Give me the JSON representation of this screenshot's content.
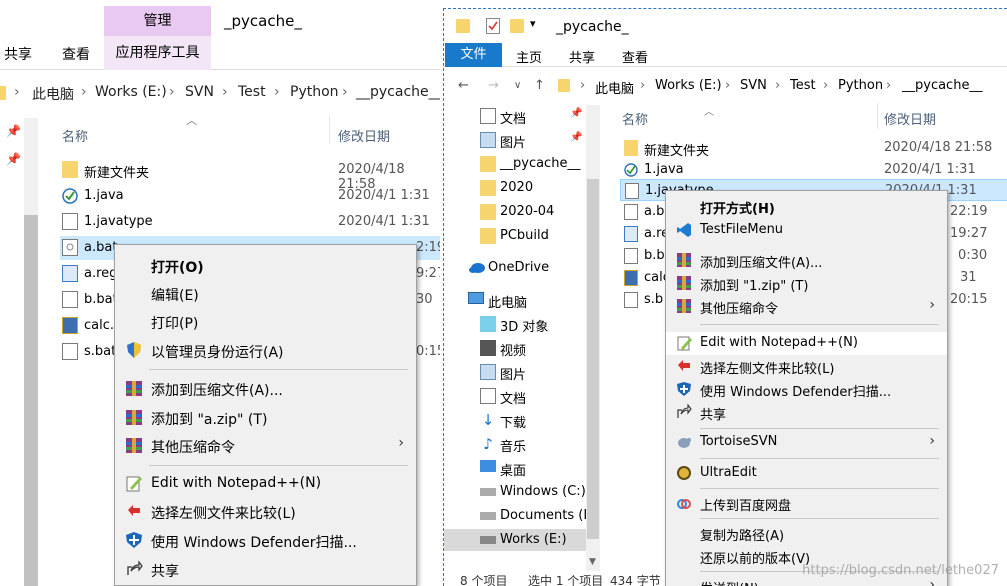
{
  "w1": {
    "manage_tab": "管理",
    "app_tools_tab": "应用程序工具",
    "share_tab": "共享",
    "view_tab": "查看",
    "title": "_pycache_",
    "addr": [
      "此电脑",
      "Works (E:)",
      "SVN",
      "Test",
      "Python",
      "__pycache__"
    ],
    "col_name": "名称",
    "col_date": "修改日期",
    "files": [
      {
        "name": "新建文件夹",
        "date": "2020/4/18 21:58"
      },
      {
        "name": "1.java",
        "date": "2020/4/1 1:31"
      },
      {
        "name": "1.javatype",
        "date": "2020/4/1 1:31"
      },
      {
        "name": "a.bat",
        "date": "2:19"
      },
      {
        "name": "a.reg",
        "date": "9:27"
      },
      {
        "name": "b.bat",
        "date": "30"
      },
      {
        "name": "calc.c",
        "date": ""
      },
      {
        "name": "s.bat",
        "date": "0:15"
      }
    ],
    "menu": {
      "open": "打开(O)",
      "edit": "编辑(E)",
      "print": "打印(P)",
      "runas": "以管理员身份运行(A)",
      "add_archive": "添加到压缩文件(A)...",
      "add_zip": "添加到 \"a.zip\" (T)",
      "other_compress": "其他压缩命令",
      "notepad": "Edit with Notepad++(N)",
      "compare": "选择左侧文件来比较(L)",
      "defender": "使用 Windows Defender扫描...",
      "share": "共享"
    }
  },
  "w2": {
    "file_tab": "文件",
    "home_tab": "主页",
    "share_tab": "共享",
    "view_tab": "查看",
    "title": "_pycache_",
    "addr": [
      "此电脑",
      "Works (E:)",
      "SVN",
      "Test",
      "Python",
      "__pycache__"
    ],
    "col_name": "名称",
    "col_date": "修改日期",
    "nav": [
      "文档",
      "图片",
      "__pycache__",
      "2020",
      "2020-04",
      "PCbuild",
      "OneDrive",
      "此电脑",
      "3D 对象",
      "视频",
      "图片",
      "文档",
      "下载",
      "音乐",
      "桌面",
      "Windows (C:)",
      "Documents (D:",
      "Works (E:)"
    ],
    "files": [
      {
        "name": "新建文件夹",
        "date": "2020/4/18 21:58"
      },
      {
        "name": "1.java",
        "date": "2020/4/1 1:31"
      },
      {
        "name": "1.javatype",
        "date": "2020/4/1 1:31"
      },
      {
        "name": "a.b",
        "date": "22:19"
      },
      {
        "name": "a.re",
        "date": "19:27"
      },
      {
        "name": "b.b",
        "date": "0:30"
      },
      {
        "name": "calc",
        "date": "31"
      },
      {
        "name": "s.b",
        "date": "20:15"
      }
    ],
    "menu": {
      "open_with": "打开方式(H)",
      "testfilemenu": "TestFileMenu",
      "add_archive": "添加到压缩文件(A)...",
      "add_zip": "添加到 \"1.zip\" (T)",
      "other_compress": "其他压缩命令",
      "notepad": "Edit with Notepad++(N)",
      "compare": "选择左侧文件来比较(L)",
      "defender": "使用 Windows Defender扫描...",
      "share": "共享",
      "tortoise": "TortoiseSVN",
      "ultraedit": "UltraEdit",
      "baidu": "上传到百度网盘",
      "copy_path": "复制为路径(A)",
      "restore": "还原以前的版本(V)",
      "send_to": "发送到(N)"
    },
    "status_count": "8 个项目",
    "status_sel": "选中 1 个项目",
    "status_size": "434 字节"
  },
  "watermark": "https://blog.csdn.net/lethe027"
}
